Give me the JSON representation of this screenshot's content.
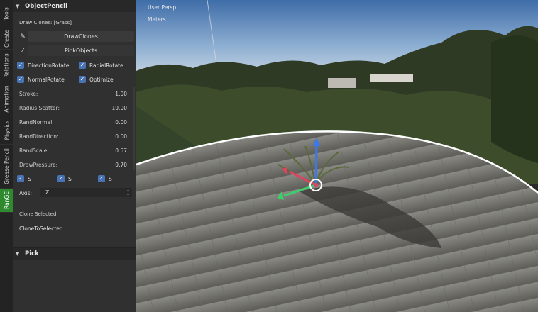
{
  "tabs": [
    "Tools",
    "Create",
    "Relations",
    "Animation",
    "Physics",
    "Grease Pencil",
    "RanGE"
  ],
  "panel": {
    "title": "ObjectPencil",
    "draw_clones_info": "Draw Clones: [Grass]",
    "draw_clones_button": "DrawClones",
    "pick_objects_button": "PickObjects",
    "checkboxes": {
      "direction_rotate": "DirectionRotate",
      "radial_rotate": "RadialRotate",
      "normal_rotate": "NormalRotate",
      "optimize": "Optimize"
    },
    "fields": [
      {
        "label": "Stroke:",
        "value": "1.00"
      },
      {
        "label": "Radius Scatter:",
        "value": "10.00"
      },
      {
        "label": "RandNormal:",
        "value": "0.00"
      },
      {
        "label": "RandDirection:",
        "value": "0.00"
      },
      {
        "label": "RandScale:",
        "value": "0.57"
      },
      {
        "label": "DrawPressure:",
        "value": "0.70"
      }
    ],
    "s_toggles": [
      "S",
      "S",
      "S"
    ],
    "axis_label": "Axis:",
    "axis_value": "Z",
    "clone_selected_label": "Clone Selected:",
    "clone_to_selected": "CloneToSelected"
  },
  "pick_panel": {
    "title": "Pick"
  },
  "viewport": {
    "view_name": "User Persp",
    "units": "Meters"
  },
  "colors": {
    "accent_blue": "#4772b3",
    "active_tab": "#2f8a2f",
    "axis_x": "#e0435f",
    "axis_y": "#3ccf6c",
    "axis_z": "#3a78f0"
  },
  "icons": [
    "collapse-chevron-icon",
    "brush-icon",
    "eyedropper-icon",
    "checkbox-icon",
    "select-arrows-icon",
    "gizmo-icon"
  ]
}
